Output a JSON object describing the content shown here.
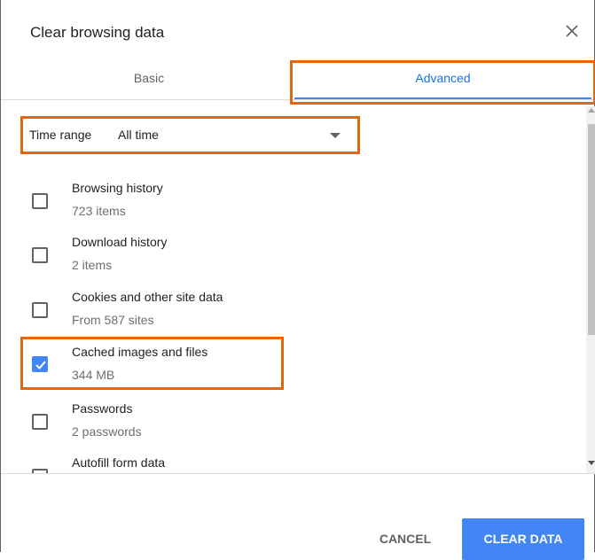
{
  "dialog": {
    "title": "Clear browsing data",
    "close_icon": "close-icon"
  },
  "tabs": [
    {
      "label": "Basic",
      "selected": false
    },
    {
      "label": "Advanced",
      "selected": true
    }
  ],
  "time_range": {
    "label": "Time range",
    "value": "All time"
  },
  "items": [
    {
      "label": "Browsing history",
      "sub": "723 items",
      "checked": false
    },
    {
      "label": "Download history",
      "sub": "2 items",
      "checked": false
    },
    {
      "label": "Cookies and other site data",
      "sub": "From 587 sites",
      "checked": false
    },
    {
      "label": "Cached images and files",
      "sub": "344 MB",
      "checked": true
    },
    {
      "label": "Passwords",
      "sub": "2 passwords",
      "checked": false
    },
    {
      "label": "Autofill form data",
      "sub": "",
      "checked": false
    }
  ],
  "footer": {
    "cancel_label": "CANCEL",
    "clear_label": "CLEAR DATA"
  },
  "colors": {
    "accent": "#4285f4",
    "highlight": "#e8650d"
  }
}
